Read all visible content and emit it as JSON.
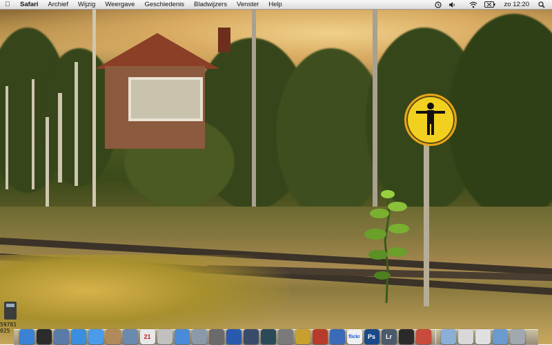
{
  "menubar": {
    "apple_icon": "apple-icon",
    "app_name": "Safari",
    "menus": [
      "Archief",
      "Wijzig",
      "Weergave",
      "Geschiedenis",
      "Bladwijzers",
      "Venster",
      "Help"
    ],
    "status_icons": [
      "time-machine-icon",
      "volume-icon",
      "wifi-icon",
      "battery-icon"
    ],
    "clock": "zo 12:20",
    "spotlight_icon": "spotlight-icon"
  },
  "widget": {
    "line1": "59781",
    "line2": "025"
  },
  "dock": {
    "items": [
      {
        "name": "finder",
        "label": "",
        "color": "#3b82d6"
      },
      {
        "name": "dashboard",
        "label": "",
        "color": "#2b2b2b"
      },
      {
        "name": "preview",
        "label": "",
        "color": "#5a7aa8"
      },
      {
        "name": "safari",
        "label": "",
        "color": "#3a8ee0"
      },
      {
        "name": "ichat",
        "label": "",
        "color": "#4c9be8"
      },
      {
        "name": "address-book",
        "label": "",
        "color": "#b08a5a"
      },
      {
        "name": "mail",
        "label": "",
        "color": "#6a8ab0"
      },
      {
        "name": "ical",
        "label": "21",
        "color": "#e8e8e8"
      },
      {
        "name": "itunes-photo",
        "label": "",
        "color": "#c0c0c0"
      },
      {
        "name": "itunes",
        "label": "",
        "color": "#4a8ad8"
      },
      {
        "name": "iphoto",
        "label": "",
        "color": "#8a9aa8"
      },
      {
        "name": "utility",
        "label": "",
        "color": "#6a6a6a"
      },
      {
        "name": "dvd-player",
        "label": "",
        "color": "#2a5ab0"
      },
      {
        "name": "spaces",
        "label": "",
        "color": "#3a4a6a"
      },
      {
        "name": "time-machine",
        "label": "",
        "color": "#2a4a5a"
      },
      {
        "name": "image-capture",
        "label": "",
        "color": "#7a7a7a"
      },
      {
        "name": "tools",
        "label": "",
        "color": "#c8a030"
      },
      {
        "name": "front-row",
        "label": "",
        "color": "#b83a2a"
      },
      {
        "name": "photo-booth",
        "label": "",
        "color": "#3a6ab8"
      },
      {
        "name": "flickr",
        "label": "flickr",
        "color": "#f0f0f0"
      },
      {
        "name": "photoshop",
        "label": "Ps",
        "color": "#1a4a8a"
      },
      {
        "name": "lightroom",
        "label": "Lr",
        "color": "#4a5a6a"
      },
      {
        "name": "aperture",
        "label": "",
        "color": "#2a2a2a"
      },
      {
        "name": "photo-stack",
        "label": "",
        "color": "#c84a3a"
      },
      {
        "name": "applications-folder",
        "label": "",
        "color": "#8ab0d8"
      },
      {
        "name": "downloads",
        "label": "",
        "color": "#d8d8d8"
      },
      {
        "name": "documents",
        "label": "",
        "color": "#e0e0e0"
      },
      {
        "name": "pictures",
        "label": "",
        "color": "#6a9ad0"
      },
      {
        "name": "trash",
        "label": "",
        "color": "#a0a8b0"
      }
    ]
  }
}
